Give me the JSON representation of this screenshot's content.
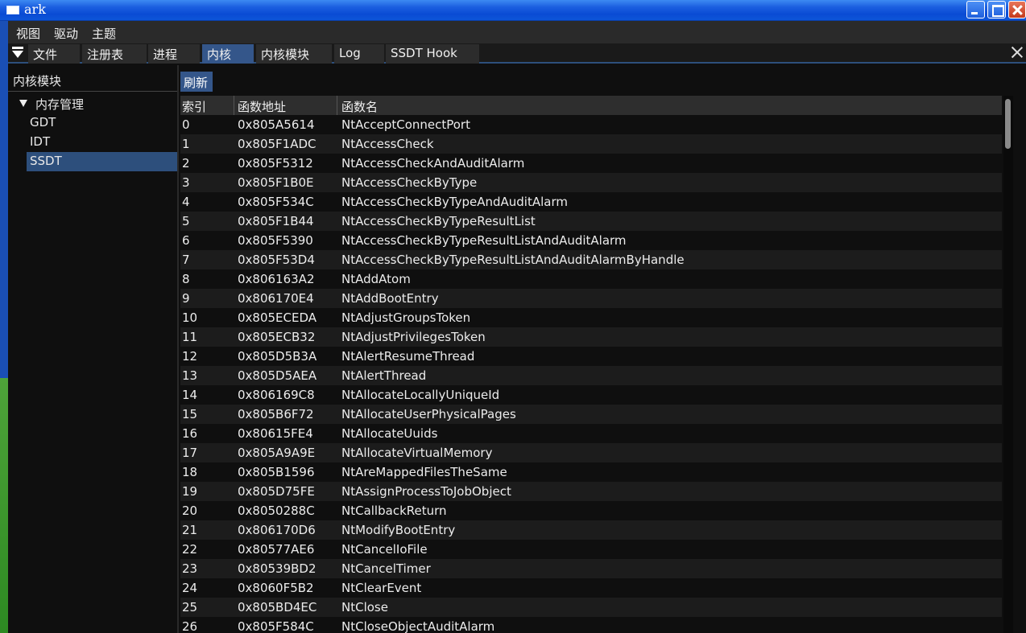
{
  "window": {
    "title": "ark"
  },
  "menu": [
    "视图",
    "驱动",
    "主题"
  ],
  "tabs": [
    {
      "label": "文件",
      "active": false
    },
    {
      "label": "注册表",
      "active": false
    },
    {
      "label": "进程",
      "active": false
    },
    {
      "label": "内核",
      "active": true
    },
    {
      "label": "内核模块",
      "active": false
    },
    {
      "label": "Log",
      "active": false
    },
    {
      "label": "SSDT Hook",
      "active": false
    }
  ],
  "tree": {
    "header": "内核模块",
    "parent": "内存管理",
    "children": [
      "GDT",
      "IDT",
      "SSDT"
    ],
    "selected": "SSDT"
  },
  "toolbar": {
    "refresh_label": "刷新"
  },
  "table": {
    "columns": [
      "索引",
      "函数地址",
      "函数名"
    ],
    "rows": [
      [
        "0",
        "0x805A5614",
        "NtAcceptConnectPort"
      ],
      [
        "1",
        "0x805F1ADC",
        "NtAccessCheck"
      ],
      [
        "2",
        "0x805F5312",
        "NtAccessCheckAndAuditAlarm"
      ],
      [
        "3",
        "0x805F1B0E",
        "NtAccessCheckByType"
      ],
      [
        "4",
        "0x805F534C",
        "NtAccessCheckByTypeAndAuditAlarm"
      ],
      [
        "5",
        "0x805F1B44",
        "NtAccessCheckByTypeResultList"
      ],
      [
        "6",
        "0x805F5390",
        "NtAccessCheckByTypeResultListAndAuditAlarm"
      ],
      [
        "7",
        "0x805F53D4",
        "NtAccessCheckByTypeResultListAndAuditAlarmByHandle"
      ],
      [
        "8",
        "0x806163A2",
        "NtAddAtom"
      ],
      [
        "9",
        "0x806170E4",
        "NtAddBootEntry"
      ],
      [
        "10",
        "0x805ECEDA",
        "NtAdjustGroupsToken"
      ],
      [
        "11",
        "0x805ECB32",
        "NtAdjustPrivilegesToken"
      ],
      [
        "12",
        "0x805D5B3A",
        "NtAlertResumeThread"
      ],
      [
        "13",
        "0x805D5AEA",
        "NtAlertThread"
      ],
      [
        "14",
        "0x806169C8",
        "NtAllocateLocallyUniqueId"
      ],
      [
        "15",
        "0x805B6F72",
        "NtAllocateUserPhysicalPages"
      ],
      [
        "16",
        "0x80615FE4",
        "NtAllocateUuids"
      ],
      [
        "17",
        "0x805A9A9E",
        "NtAllocateVirtualMemory"
      ],
      [
        "18",
        "0x805B1596",
        "NtAreMappedFilesTheSame"
      ],
      [
        "19",
        "0x805D75FE",
        "NtAssignProcessToJobObject"
      ],
      [
        "20",
        "0x8050288C",
        "NtCallbackReturn"
      ],
      [
        "21",
        "0x806170D6",
        "NtModifyBootEntry"
      ],
      [
        "22",
        "0x80577AE6",
        "NtCancelIoFile"
      ],
      [
        "23",
        "0x80539BD2",
        "NtCancelTimer"
      ],
      [
        "24",
        "0x8060F5B2",
        "NtClearEvent"
      ],
      [
        "25",
        "0x805BD4EC",
        "NtClose"
      ],
      [
        "26",
        "0x805F584C",
        "NtCloseObjectAuditAlarm"
      ]
    ]
  },
  "colors": {
    "accent": "#34568a",
    "selected": "#2d4f7c",
    "background": "#0f0f0f",
    "row_alt": "#1c1c1c"
  }
}
